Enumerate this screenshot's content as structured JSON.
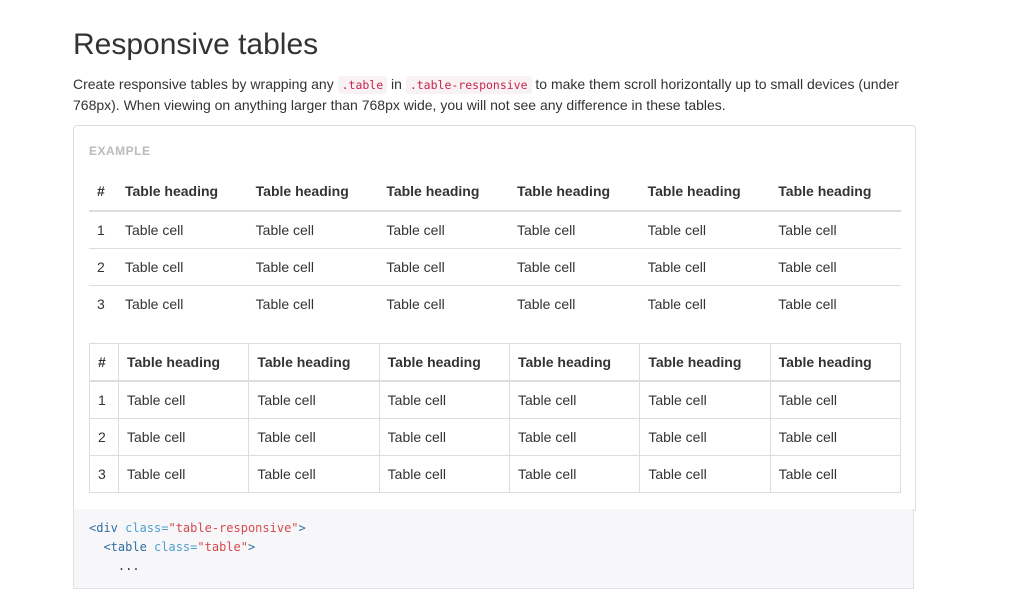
{
  "page": {
    "title": "Responsive tables",
    "lead": {
      "part1": "Create responsive tables by wrapping any ",
      "code1": ".table",
      "part2": " in ",
      "code2": ".table-responsive",
      "part3": " to make them scroll horizontally up to small devices (under 768px). When viewing on anything larger than 768px wide, you will not see any difference in these tables."
    }
  },
  "example": {
    "label": "EXAMPLE",
    "table": {
      "headers": [
        "#",
        "Table heading",
        "Table heading",
        "Table heading",
        "Table heading",
        "Table heading",
        "Table heading"
      ],
      "rows": [
        [
          "1",
          "Table cell",
          "Table cell",
          "Table cell",
          "Table cell",
          "Table cell",
          "Table cell"
        ],
        [
          "2",
          "Table cell",
          "Table cell",
          "Table cell",
          "Table cell",
          "Table cell",
          "Table cell"
        ],
        [
          "3",
          "Table cell",
          "Table cell",
          "Table cell",
          "Table cell",
          "Table cell",
          "Table cell"
        ]
      ]
    },
    "table_bordered": {
      "headers": [
        "#",
        "Table heading",
        "Table heading",
        "Table heading",
        "Table heading",
        "Table heading",
        "Table heading"
      ],
      "rows": [
        [
          "1",
          "Table cell",
          "Table cell",
          "Table cell",
          "Table cell",
          "Table cell",
          "Table cell"
        ],
        [
          "2",
          "Table cell",
          "Table cell",
          "Table cell",
          "Table cell",
          "Table cell",
          "Table cell"
        ],
        [
          "3",
          "Table cell",
          "Table cell",
          "Table cell",
          "Table cell",
          "Table cell",
          "Table cell"
        ]
      ]
    }
  },
  "code": {
    "line1": {
      "open": "<div",
      "attr": " class=",
      "value": "\"table-responsive\"",
      "close": ">"
    },
    "line2": {
      "open": "<table",
      "attr": " class=",
      "value": "\"table\"",
      "close": ">"
    },
    "line3": "..."
  },
  "colors": {
    "code_inline": "#c7254e",
    "code_bg": "#f9f2f4",
    "border": "#dddddd",
    "label": "#bbbbbb"
  }
}
